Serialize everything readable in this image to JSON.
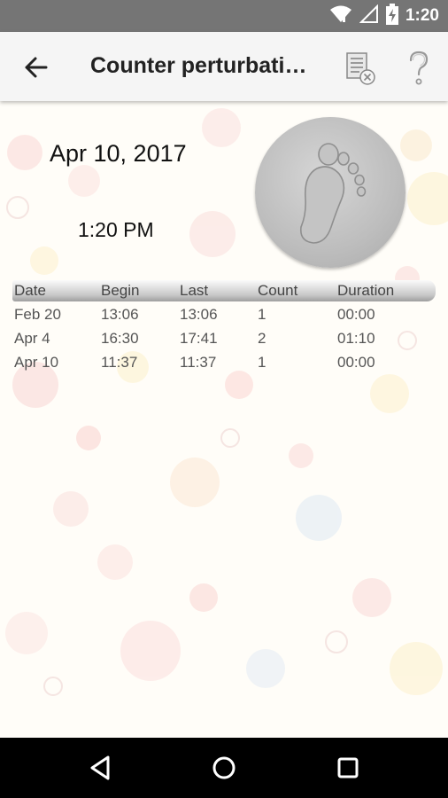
{
  "status_bar": {
    "time": "1:20",
    "icons": [
      "wifi-icon",
      "signal-icon",
      "battery-charging-icon"
    ]
  },
  "toolbar": {
    "title": "Counter perturbati…",
    "back_icon": "arrow-left-icon",
    "clear_icon": "clear-list-icon",
    "help_icon": "question-mark-icon"
  },
  "main": {
    "date": "Apr 10, 2017",
    "time": "1:20 PM",
    "counter_icon": "footprint-icon"
  },
  "table": {
    "headers": [
      "Date",
      "Begin",
      "Last",
      "Count",
      "Duration"
    ],
    "rows": [
      [
        "Feb 20",
        "13:06",
        "13:06",
        "1",
        "00:00"
      ],
      [
        "Apr 4",
        "16:30",
        "17:41",
        "2",
        "01:10"
      ],
      [
        "Apr 10",
        "11:37",
        "11:37",
        "1",
        "00:00"
      ]
    ]
  },
  "nav_bar": {
    "icons": [
      "back-triangle-icon",
      "home-circle-icon",
      "recents-square-icon"
    ]
  }
}
